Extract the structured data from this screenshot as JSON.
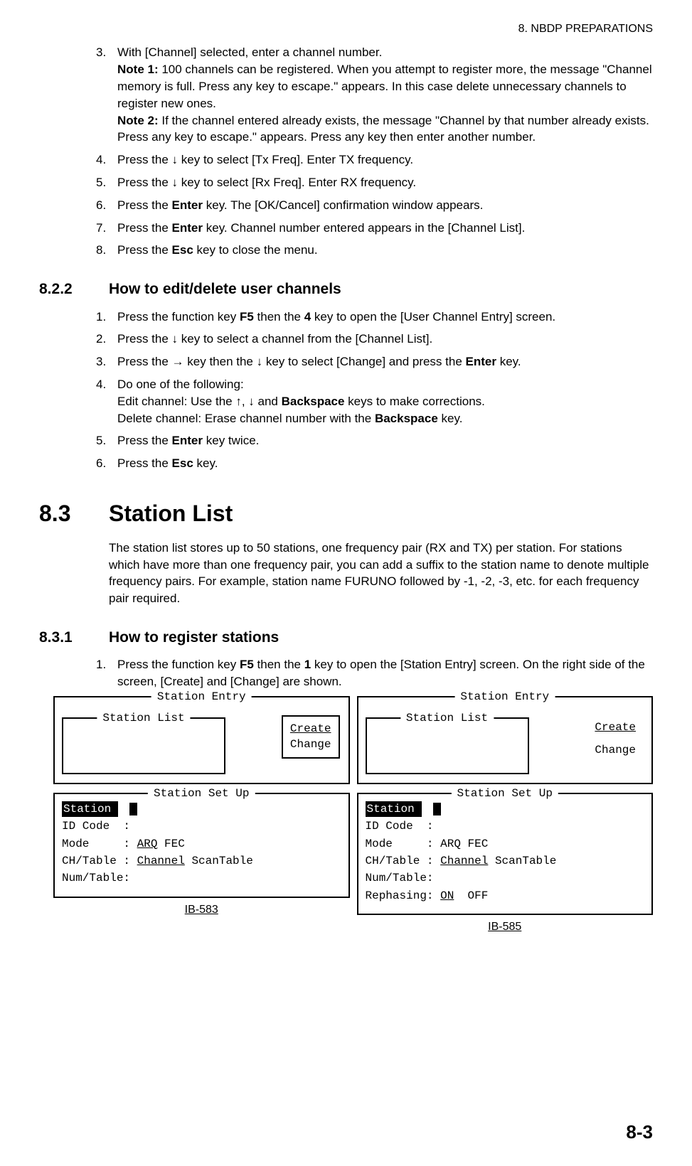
{
  "header": "8.  NBDP PREPARATIONS",
  "step3": {
    "num": "3.",
    "line1": "With [Channel] selected, enter a channel number.",
    "note1_label": "Note 1:",
    "note1_text": " 100 channels can be registered. When you attempt to register more, the message \"Channel memory is full. Press any key to escape.\" appears. In this case delete unnecessary channels to register new ones.",
    "note2_label": "Note 2:",
    "note2_text": " If the channel entered already exists, the message \"Channel by that number already exists. Press any key to escape.\" appears. Press any key then enter another number."
  },
  "step4": {
    "num": "4.",
    "t1": "Press the ",
    "arrow": "↓",
    "t2": " key to select [Tx Freq]. Enter TX frequency."
  },
  "step5": {
    "num": "5.",
    "t1": "Press the ",
    "arrow": "↓",
    "t2": " key to select [Rx Freq]. Enter RX frequency."
  },
  "step6": {
    "num": "6.",
    "t1": "Press the ",
    "k": "Enter",
    "t2": " key. The [OK/Cancel] confirmation window appears."
  },
  "step7": {
    "num": "7.",
    "t1": "Press the ",
    "k": "Enter",
    "t2": " key. Channel number entered appears in the [Channel List]."
  },
  "step8": {
    "num": "8.",
    "t1": "Press the ",
    "k": "Esc",
    "t2": " key to close the menu."
  },
  "sec822": {
    "num": "8.2.2",
    "title": "How to edit/delete user channels"
  },
  "e1": {
    "num": "1.",
    "t1": "Press the function key ",
    "k1": "F5",
    "t2": " then the ",
    "k2": "4",
    "t3": " key to open the [User Channel Entry] screen."
  },
  "e2": {
    "num": "2.",
    "t1": "Press the ",
    "arrow": "↓",
    "t2": " key to select a channel from the [Channel List]."
  },
  "e3": {
    "num": "3.",
    "t1": "Press the ",
    "arrow1": "→",
    "t2": " key then the ",
    "arrow2": "↓",
    "t3": " key to select [Change] and press the ",
    "k": "Enter",
    "t4": " key."
  },
  "e4": {
    "num": "4.",
    "l1": "Do one of the following:",
    "l2a": "Edit channel: Use the ",
    "up": "↑",
    "comma": ", ",
    "down": "↓",
    "l2b": " and ",
    "bs": "Backspace",
    "l2c": " keys to make corrections.",
    "l3a": "Delete channel: Erase channel number with the ",
    "bs2": "Backspace",
    "l3b": " key."
  },
  "e5": {
    "num": "5.",
    "t1": "Press the ",
    "k": "Enter",
    "t2": " key twice."
  },
  "e6": {
    "num": "6.",
    "t1": "Press the ",
    "k": "Esc",
    "t2": " key."
  },
  "sec83": {
    "num": "8.3",
    "title": "Station List"
  },
  "para83": "The station list stores up to 50 stations, one frequency pair (RX and TX) per station. For stations which have more than one frequency pair, you can add a suffix to the station name to denote multiple frequency pairs. For example, station name FURUNO followed by -1, -2, -3, etc. for each frequency pair required.",
  "sec831": {
    "num": "8.3.1",
    "title": "How to register stations"
  },
  "r1": {
    "num": "1.",
    "t1": "Press the function key ",
    "k1": "F5",
    "t2": " then the ",
    "k2": "1",
    "t3": " key to open the [Station Entry] screen. On the right side of the screen, [Create] and [Change] are shown."
  },
  "diagram": {
    "entry_title": "Station Entry",
    "list_title": "Station List",
    "create": "Create",
    "change": "Change",
    "setup_title": "Station Set Up",
    "station_label": "Station",
    "idcode": "ID Code  :",
    "mode_a": "Mode     : ",
    "mode_arq": "ARQ",
    "mode_fec": " FEC",
    "chtable_a": "CH/Table : ",
    "channel_u": "Channel",
    "scantable": " ScanTable",
    "numtable": "Num/Table:",
    "rephasing_a": "Rephasing: ",
    "on_u": "ON",
    "off": "  OFF",
    "mode_plain": "Mode     : ARQ FEC"
  },
  "caption_left": "IB-583",
  "caption_right": "IB-585",
  "pagefoot": "8-3"
}
